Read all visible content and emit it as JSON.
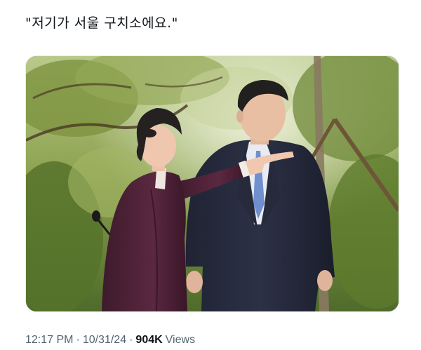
{
  "post": {
    "text": "\"저기가 서울 구치소에요.\""
  },
  "media": {
    "type": "photo"
  },
  "meta": {
    "time": "12:17 PM",
    "separator": "·",
    "date": "10/31/24",
    "views_count": "904K",
    "views_label": "Views"
  },
  "colors": {
    "text_primary": "#0f1419",
    "text_secondary": "#536471",
    "background": "#ffffff"
  }
}
